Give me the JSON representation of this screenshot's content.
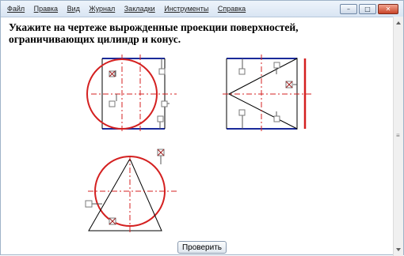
{
  "menu": {
    "items": [
      "Файл",
      "Правка",
      "Вид",
      "Журнал",
      "Закладки",
      "Инструменты",
      "Справка"
    ]
  },
  "window_controls": {
    "minimize": "–",
    "maximize": "□",
    "close": "✕"
  },
  "question": {
    "text": "Укажите на чертеже вырожденные проекции поверхностей, ограничивающих цилиндр и конус."
  },
  "actions": {
    "check_label": "Проверить"
  },
  "colors": {
    "circle": "#d42020",
    "square_edges": "#1a2a9a",
    "axis": "#d42020",
    "outline": "#000000"
  },
  "checkboxes": [
    {
      "id": "v1-top-left",
      "checked": true
    },
    {
      "id": "v1-top-right",
      "checked": false
    },
    {
      "id": "v1-left",
      "checked": false
    },
    {
      "id": "v1-right",
      "checked": false
    },
    {
      "id": "v1-bottom-right",
      "checked": false
    },
    {
      "id": "v2-top-left",
      "checked": false
    },
    {
      "id": "v2-top-mid",
      "checked": false
    },
    {
      "id": "v2-right",
      "checked": true
    },
    {
      "id": "v2-bottom-left",
      "checked": false
    },
    {
      "id": "v2-bottom-mid",
      "checked": false
    },
    {
      "id": "v3-top",
      "checked": true
    },
    {
      "id": "v3-left",
      "checked": false
    },
    {
      "id": "v3-bottom",
      "checked": true
    }
  ]
}
